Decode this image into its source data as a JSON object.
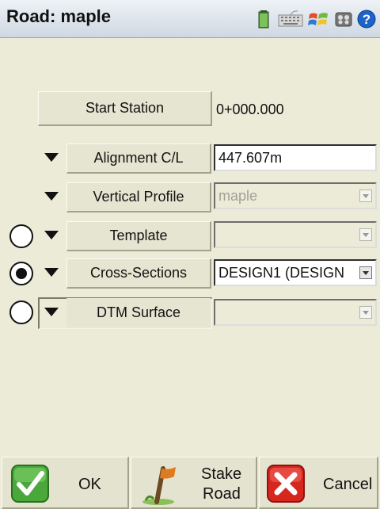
{
  "title": "Road: maple",
  "titlebar_icons": [
    "battery-icon",
    "keyboard-icon",
    "windows-logo-icon",
    "settings-icon",
    "help-icon"
  ],
  "colors": {
    "background": "#ecebd8",
    "field_border": "#2f2f2f"
  },
  "start_station": {
    "label": "Start Station",
    "value": "0+000.000"
  },
  "rows": {
    "alignment": {
      "label": "Alignment C/L",
      "value": "447.607m"
    },
    "vertical_profile": {
      "label": "Vertical Profile",
      "value": "maple"
    },
    "template": {
      "label": "Template",
      "value": "",
      "selected": false
    },
    "cross_sections": {
      "label": "Cross-Sections",
      "value": "DESIGN1 (DESIGN",
      "selected": true
    },
    "dtm_surface": {
      "label": "DTM Surface",
      "value": "",
      "selected": false
    }
  },
  "bottom": {
    "ok": "OK",
    "stake_line1": "Stake",
    "stake_line2": "Road",
    "cancel": "Cancel"
  }
}
